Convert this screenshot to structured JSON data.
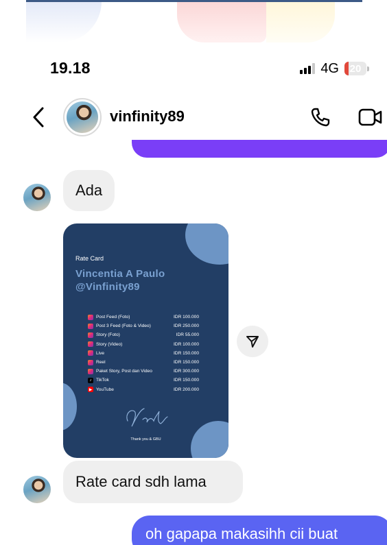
{
  "status_bar": {
    "time": "19.18",
    "network": "4G",
    "battery": "20",
    "battery_level_percent": 20,
    "signal_bars": 3
  },
  "header": {
    "username": "vinfinity89",
    "avatar_icon": "avatar-photo",
    "back_icon": "chevron-left-icon",
    "call_icon": "phone-icon",
    "video_icon": "video-camera-icon"
  },
  "messages": {
    "received_1": "Ada",
    "received_2": "Rate card sdh lama",
    "sent_1": "oh gapapa makasihh cii buat"
  },
  "rate_card": {
    "label": "Rate Card",
    "name_line1": "Vincentia A Paulo",
    "name_line2": "@Vinfinity89",
    "items": [
      {
        "service": "Post Feed (Foto)",
        "price": "IDR 100.000",
        "icon": "instagram"
      },
      {
        "service": "Post 3 Feed (Foto & Video)",
        "price": "IDR 250.000",
        "icon": "instagram"
      },
      {
        "service": "Story (Foto)",
        "price": "IDR 55.000",
        "icon": "instagram"
      },
      {
        "service": "Story (Video)",
        "price": "IDR 100.000",
        "icon": "instagram"
      },
      {
        "service": "Live",
        "price": "IDR 150.000",
        "icon": "instagram"
      },
      {
        "service": "Reel",
        "price": "IDR 150.000",
        "icon": "instagram"
      },
      {
        "service": "Paket Story, Post dan Video",
        "price": "IDR 300.000",
        "icon": "instagram"
      },
      {
        "service": "TikTok",
        "price": "IDR 150.000",
        "icon": "tiktok"
      },
      {
        "service": "YouTube",
        "price": "IDR 200.000",
        "icon": "youtube"
      }
    ],
    "signature": "Vintul",
    "thanks": "Thank you & GBU"
  },
  "actions": {
    "share_icon": "send-icon"
  },
  "colors": {
    "sent_bubble": "#5a64f2",
    "sent_bubble_top": "#7a3ef7",
    "received_bubble": "#efefef",
    "rate_card_bg": "#223e65",
    "rate_card_accent": "#7aa1d1",
    "battery_low": "#e1483a"
  }
}
